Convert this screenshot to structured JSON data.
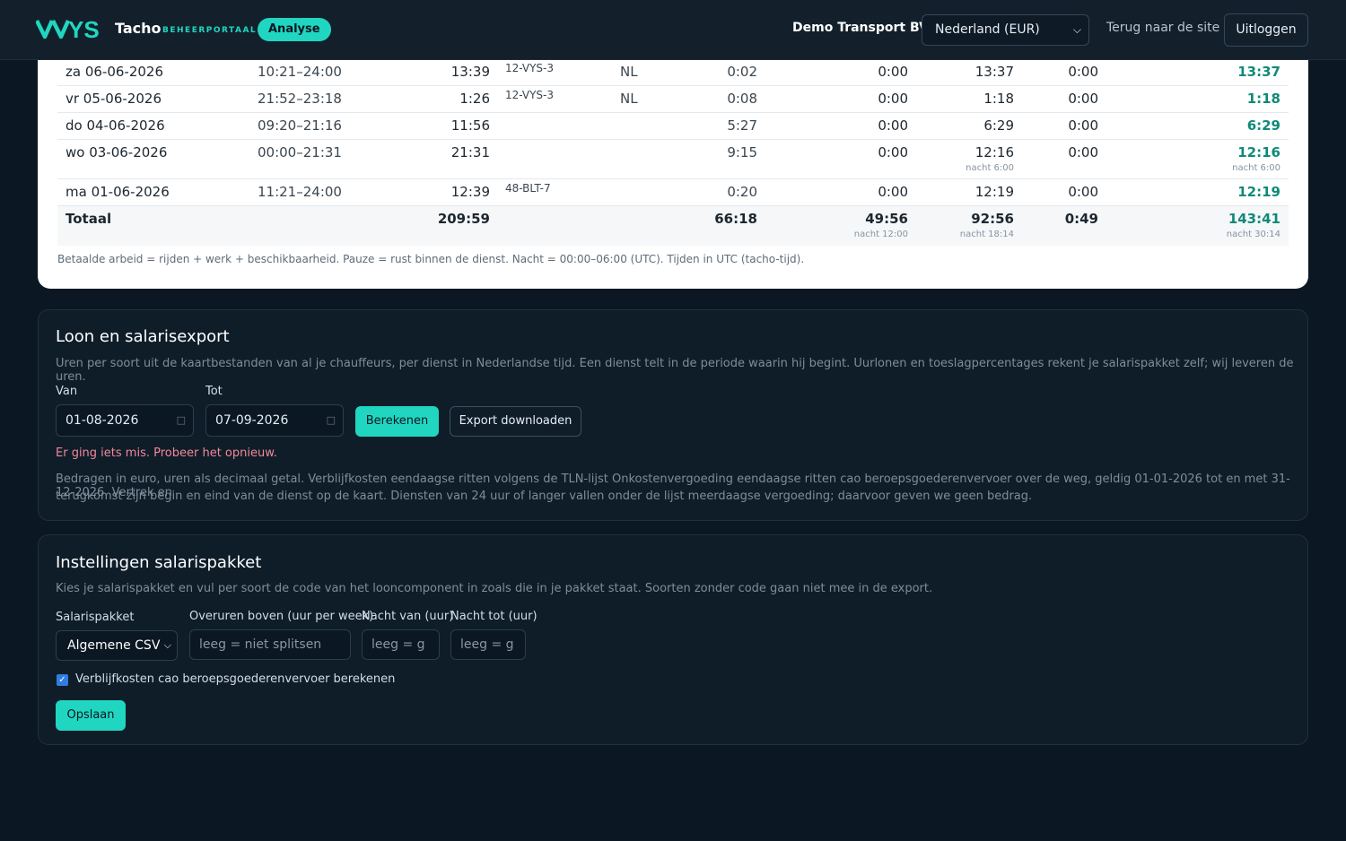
{
  "header": {
    "brand": "Tacho",
    "brand_sub": "BEHEERPORTAAL",
    "badge": "Analyse",
    "company": "Demo Transport BV",
    "country_select": "Nederland (EUR)",
    "back_link": "Terug naar de site",
    "logout": "Uitloggen"
  },
  "table": {
    "rows": [
      {
        "date": "za 06-06-2026",
        "time": "10:21–24:00",
        "duration": "13:39",
        "plate": "12-VYS-3",
        "country": "NL",
        "pauze": "0:02",
        "c6": "0:00",
        "c7": "13:37",
        "c7_sub": "",
        "c8": "0:00",
        "c9": "13:37",
        "c9_sub": ""
      },
      {
        "date": "vr 05-06-2026",
        "time": "21:52–23:18",
        "duration": "1:26",
        "plate": "12-VYS-3",
        "country": "NL",
        "pauze": "0:08",
        "c6": "0:00",
        "c7": "1:18",
        "c7_sub": "",
        "c8": "0:00",
        "c9": "1:18",
        "c9_sub": ""
      },
      {
        "date": "do 04-06-2026",
        "time": "09:20–21:16",
        "duration": "11:56",
        "plate": "",
        "country": "",
        "pauze": "5:27",
        "c6": "0:00",
        "c7": "6:29",
        "c7_sub": "",
        "c8": "0:00",
        "c9": "6:29",
        "c9_sub": ""
      },
      {
        "date": "wo 03-06-2026",
        "time": "00:00–21:31",
        "duration": "21:31",
        "plate": "",
        "country": "",
        "pauze": "9:15",
        "c6": "0:00",
        "c7": "12:16",
        "c7_sub": "nacht 6:00",
        "c8": "0:00",
        "c9": "12:16",
        "c9_sub": "nacht 6:00"
      },
      {
        "date": "ma 01-06-2026",
        "time": "11:21–24:00",
        "duration": "12:39",
        "plate": "48-BLT-7",
        "country": "",
        "pauze": "0:20",
        "c6": "0:00",
        "c7": "12:19",
        "c7_sub": "",
        "c8": "0:00",
        "c9": "12:19",
        "c9_sub": ""
      }
    ],
    "total": {
      "label": "Totaal",
      "duration": "209:59",
      "pauze": "66:18",
      "c6": "49:56",
      "c6_sub": "nacht 12:00",
      "c7": "92:56",
      "c7_sub": "nacht 18:14",
      "c8": "0:49",
      "c9": "143:41",
      "c9_sub": "nacht 30:14"
    },
    "note": "Betaalde arbeid = rijden + werk + beschikbaarheid. Pauze = rust binnen de dienst. Nacht = 00:00–06:00 (UTC). Tijden in UTC (tacho-tijd)."
  },
  "payroll": {
    "title": "Loon en salarisexport",
    "description": "Uren per soort uit de kaartbestanden van al je chauffeurs, per dienst in Nederlandse tijd. Een dienst telt in de periode waarin hij begint. Uurlonen en toeslagpercentages rekent je salarispakket zelf; wij leveren de uren.",
    "from_label": "Van",
    "from_value": "01-08-2026",
    "to_label": "Tot",
    "to_value": "07-09-2026",
    "calculate_button": "Berekenen",
    "export_button": "Export downloaden",
    "error": "Er ging iets mis. Probeer het opnieuw.",
    "footnote_line1": "Bedragen in euro, uren als decimaal getal. Verblijfkosten eendaagse ritten volgens de TLN-lijst Onkostenvergoeding eendaagse ritten cao beroepsgoederenvervoer over de weg, geldig 01-01-2026 tot en met 31-12-2026. Vertrek en",
    "footnote_line2": "terugkomst zijn begin en eind van de dienst op de kaart. Diensten van 24 uur of langer vallen onder de lijst meerdaagse vergoeding; daarvoor geven we geen bedrag."
  },
  "settings": {
    "title": "Instellingen salarispakket",
    "description": "Kies je salarispakket en vul per soort de code van het looncomponent in zoals die in je pakket staat. Soorten zonder code gaan niet mee in de export.",
    "package_label": "Salarispakket",
    "package_value": "Algemene CSV",
    "overtime_label": "Overuren boven (uur per week)",
    "overtime_placeholder": "leeg = niet splitsen",
    "night_from_label": "Nacht van (uur)",
    "night_from_placeholder": "leeg = g",
    "night_to_label": "Nacht tot (uur)",
    "night_to_placeholder": "leeg = g",
    "checkbox_label": "Verblijfkosten cao beroepsgoederenvervoer berekenen",
    "checkbox_checked": true,
    "save_button": "Opslaan"
  }
}
